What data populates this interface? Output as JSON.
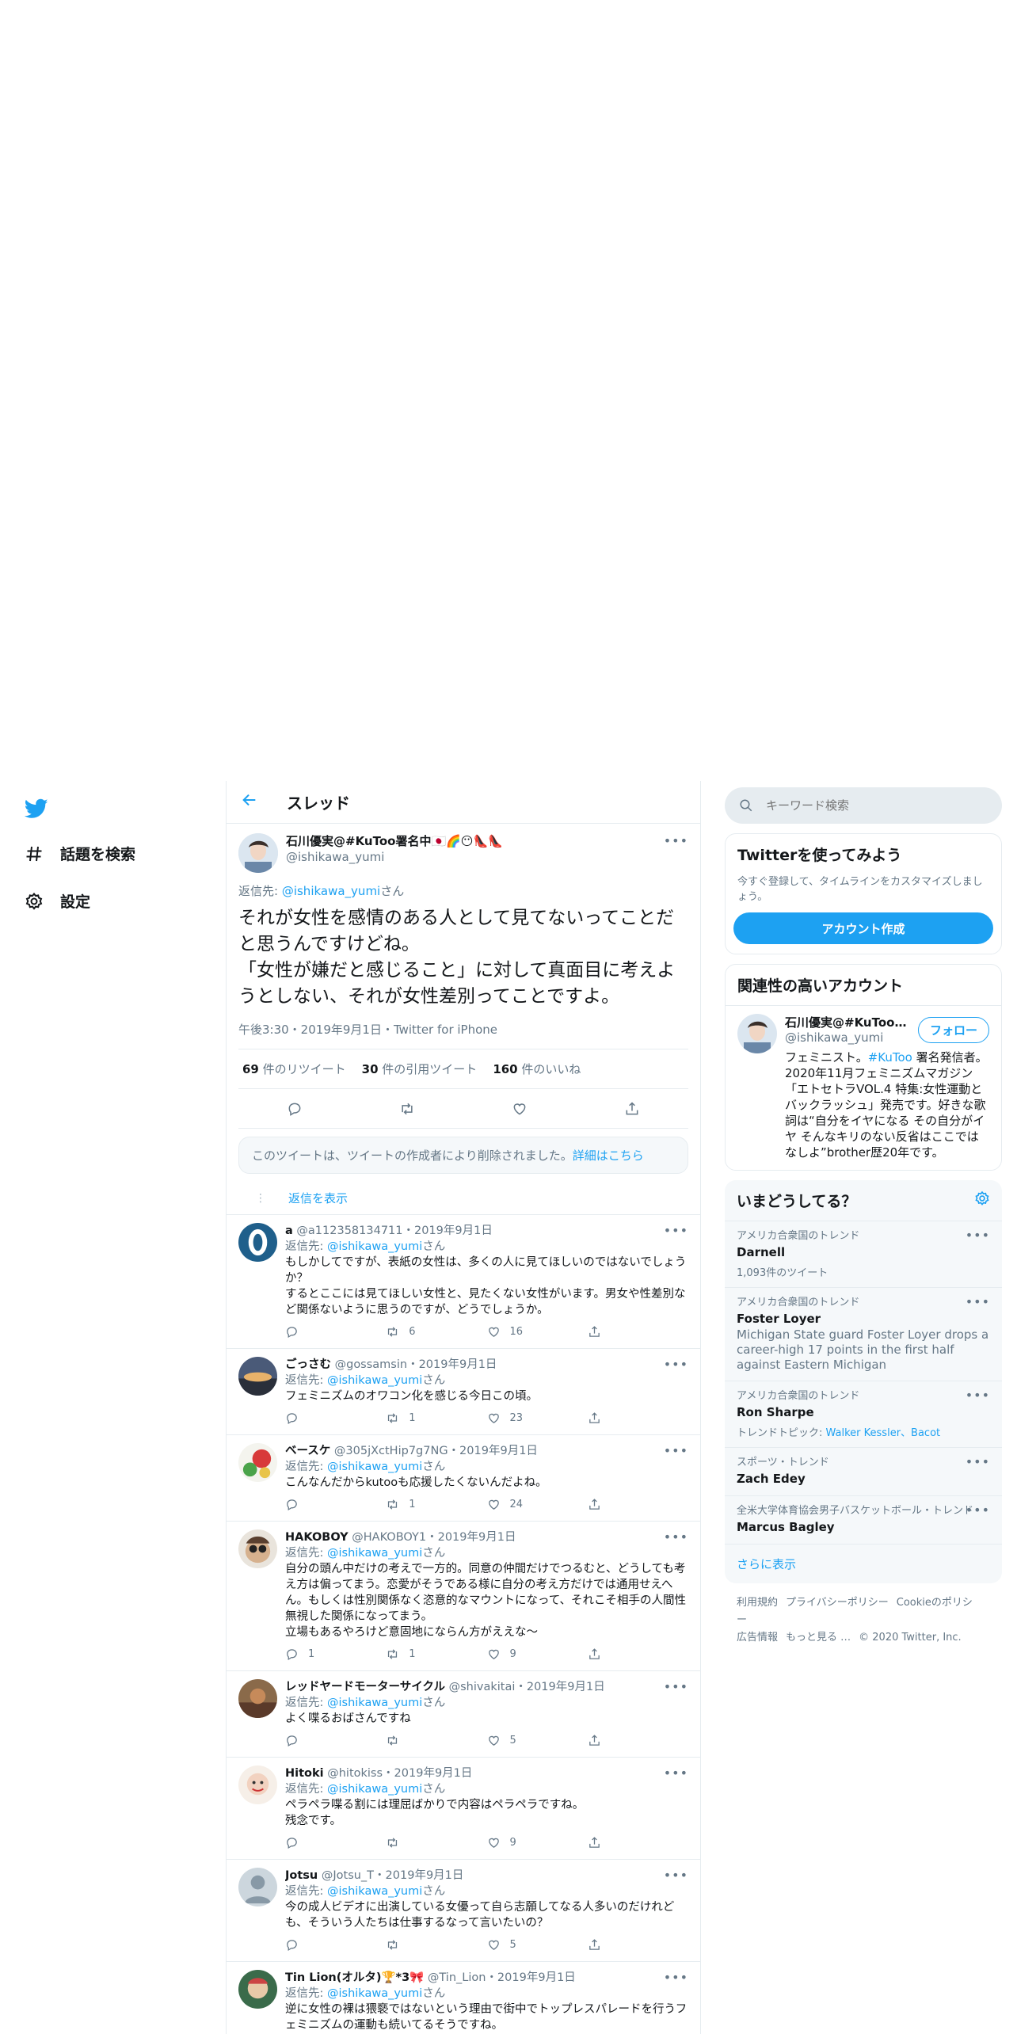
{
  "nav": {
    "items": [
      {
        "label": "話題を検索",
        "icon": "hashtag-icon"
      },
      {
        "label": "設定",
        "icon": "gear-icon"
      }
    ]
  },
  "header": {
    "title": "スレッド"
  },
  "main_tweet": {
    "name": "石川優実@#KuToo署名中🇯🇵🌈😶👠👠",
    "handle": "@ishikawa_yumi",
    "reply_prefix": "返信先: ",
    "reply_handle": "@ishikawa_yumi",
    "reply_suffix": "さん",
    "text": "それが女性を感情のある人として見てないってことだと思うんですけどね。\n「女性が嫌だと感じること」に対して真面目に考えようとしない、それが女性差別ってことですよ。",
    "meta": "午後3:30・2019年9月1日・Twitter for iPhone",
    "retweets_count": "69",
    "retweets_label": " 件のリツイート",
    "quotes_count": "30",
    "quotes_label": " 件の引用ツイート",
    "likes_count": "160",
    "likes_label": " 件のいいね"
  },
  "deleted_notice": {
    "text": "このツイートは、ツイートの作成者により削除されました。",
    "link": "詳細はこちら"
  },
  "show_replies": "返信を表示",
  "replies": [
    {
      "name": "a",
      "handle": "@a112358134711",
      "date": "・2019年9月1日",
      "reply_prefix": "返信先: ",
      "reply_handle": "@ishikawa_yumi",
      "reply_suffix": "さん",
      "text": "もしかしてですが、表紙の女性は、多くの人に見てほしいのではないでしょうか？\nするとここには見てほしい女性と、見たくない女性がいます。男女や性差別など関係ないように思うのですが、どうでしょうか。",
      "retweets": "6",
      "likes": "16",
      "replies": ""
    },
    {
      "name": "ごっさむ",
      "handle": "@gossamsin",
      "date": "・2019年9月1日",
      "reply_prefix": "返信先: ",
      "reply_handle": "@ishikawa_yumi",
      "reply_suffix": "さん",
      "text": "フェミニズムのオワコン化を感じる今日この頃。",
      "retweets": "1",
      "likes": "23",
      "replies": ""
    },
    {
      "name": "ベースケ",
      "handle": "@305jXctHip7g7NG",
      "date": "・2019年9月1日",
      "reply_prefix": "返信先: ",
      "reply_handle": "@ishikawa_yumi",
      "reply_suffix": "さん",
      "text": "こんなんだからkutooも応援したくないんだよね。",
      "retweets": "1",
      "likes": "24",
      "replies": ""
    },
    {
      "name": "HAKOBOY",
      "handle": "@HAKOBOY1",
      "date": "・2019年9月1日",
      "reply_prefix": "返信先: ",
      "reply_handle": "@ishikawa_yumi",
      "reply_suffix": "さん",
      "text": "自分の頭ん中だけの考えで一方的。同意の仲間だけでつるむと、どうしても考え方は偏ってまう。恋愛がそうである様に自分の考え方だけでは通用せえへん。もしくは性別関係なく恣意的なマウントになって、それこそ相手の人間性無視した関係になってまう。\n立場もあるやろけど意固地にならん方がええな～",
      "retweets": "1",
      "likes": "9",
      "replies": "1"
    },
    {
      "name": "レッドヤードモーターサイクル",
      "handle": "@shivakitai",
      "date": "・2019年9月1日",
      "reply_prefix": "返信先: ",
      "reply_handle": "@ishikawa_yumi",
      "reply_suffix": "さん",
      "text": "よく喋るおばさんですね",
      "retweets": "",
      "likes": "5",
      "replies": ""
    },
    {
      "name": "Hitoki",
      "handle": "@hitokiss",
      "date": "・2019年9月1日",
      "reply_prefix": "返信先: ",
      "reply_handle": "@ishikawa_yumi",
      "reply_suffix": "さん",
      "text": "ペラペラ喋る割には理屈ばかりで内容はペラペラですね。\n残念です。",
      "retweets": "",
      "likes": "9",
      "replies": ""
    },
    {
      "name": "Jotsu",
      "handle": "@Jotsu_T",
      "date": "・2019年9月1日",
      "reply_prefix": "返信先: ",
      "reply_handle": "@ishikawa_yumi",
      "reply_suffix": "さん",
      "text": "今の成人ビデオに出演している女優って自ら志願してなる人多いのだけれども、そういう人たちは仕事するなって言いたいの？",
      "retweets": "",
      "likes": "5",
      "replies": ""
    },
    {
      "name": "Tin Lion(オルタ)🏆*3🎀",
      "handle": "@Tin_Lion",
      "date": "・2019年9月1日",
      "reply_prefix": "返信先: ",
      "reply_handle": "@ishikawa_yumi",
      "reply_suffix": "さん",
      "text": "逆に女性の裸は猥褻ではないという理由で街中でトップレスパレードを行うフェミニズムの運動も続いてるそうですね。",
      "retweets": "",
      "likes": "",
      "replies": ""
    }
  ],
  "search": {
    "placeholder": "キーワード検索"
  },
  "signup": {
    "title": "Twitterを使ってみよう",
    "desc": "今すぐ登録して、タイムラインをカスタマイズしましょう。",
    "button": "アカウント作成"
  },
  "related": {
    "title": "関連性の高いアカウント",
    "name": "石川優実@#KuToo署名中🇯🇵🌈",
    "handle": "@ishikawa_yumi",
    "follow": "フォロー",
    "bio_before": "フェミニスト。",
    "bio_link": "#KuToo",
    "bio_after": " 署名発信者。2020年11月フェミニズムマガジン「エトセトラVOL.4 特集:女性運動とバックラッシュ」発売です。好きな歌詞は“自分をイヤになる その自分がイヤ そんなキリのない反省はここではなしよ”brother歴20年です。"
  },
  "trends": {
    "title": "いまどうしてる？",
    "items": [
      {
        "ctx": "アメリカ合衆国のトレンド",
        "name": "Darnell",
        "sub": "1,093件のツイート",
        "desc": "",
        "topic_label": "",
        "topics": ""
      },
      {
        "ctx": "アメリカ合衆国のトレンド",
        "name": "Foster Loyer",
        "sub": "",
        "desc": "Michigan State guard Foster Loyer drops a career-high 17 points in the first half against Eastern Michigan",
        "topic_label": "",
        "topics": ""
      },
      {
        "ctx": "アメリカ合衆国のトレンド",
        "name": "Ron Sharpe",
        "sub": "",
        "desc": "",
        "topic_label": "トレンドトピック: ",
        "topics": "Walker Kessler、Bacot"
      },
      {
        "ctx": "スポーツ・トレンド",
        "name": "Zach Edey",
        "sub": "",
        "desc": "",
        "topic_label": "",
        "topics": ""
      },
      {
        "ctx": "全米大学体育協会男子バスケットボール・トレンド",
        "name": "Marcus Bagley",
        "sub": "",
        "desc": "",
        "topic_label": "",
        "topics": ""
      }
    ],
    "show_more": "さらに表示"
  },
  "footer": {
    "links": [
      "利用規約",
      "プライバシーポリシー",
      "Cookieのポリシー",
      "広告情報",
      "もっと見る …"
    ],
    "copyright": "© 2020 Twitter, Inc."
  }
}
